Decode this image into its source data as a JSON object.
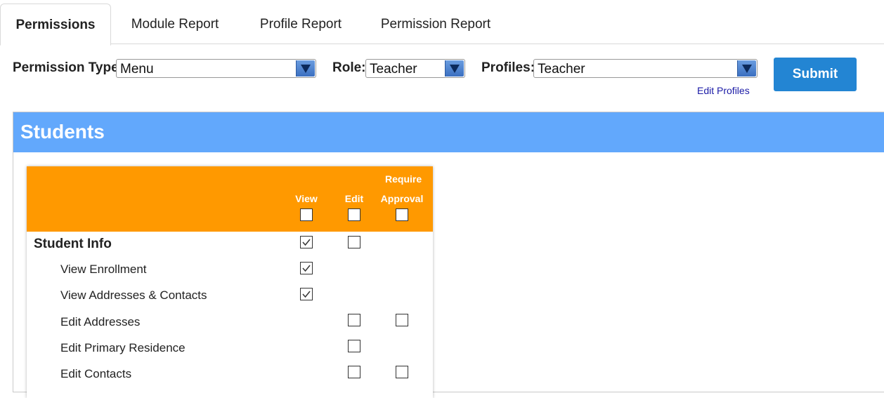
{
  "tabs": [
    {
      "label": "Permissions",
      "active": true
    },
    {
      "label": "Module Report",
      "active": false
    },
    {
      "label": "Profile Report",
      "active": false
    },
    {
      "label": "Permission Report",
      "active": false
    }
  ],
  "filters": {
    "permission_type_label": "Permission Type:",
    "permission_type_value": "Menu",
    "role_label": "Role:",
    "role_value": "Teacher",
    "profiles_label": "Profiles:",
    "profiles_value": "Teacher",
    "edit_profiles_link": "Edit Profiles",
    "submit_label": "Submit"
  },
  "section": {
    "title": "Students",
    "columns": {
      "view": "View",
      "edit": "Edit",
      "require_line1": "Require",
      "require_line2": "Approval"
    },
    "header_checks": {
      "view": false,
      "edit": false,
      "require": false
    },
    "rows": [
      {
        "label": "Student Info",
        "level": 0,
        "view": true,
        "edit": false,
        "require": null
      },
      {
        "label": "View Enrollment",
        "level": 1,
        "view": true,
        "edit": null,
        "require": null
      },
      {
        "label": "View Addresses & Contacts",
        "level": 1,
        "view": true,
        "edit": null,
        "require": null
      },
      {
        "label": "Edit Addresses",
        "level": 1,
        "view": null,
        "edit": false,
        "require": false
      },
      {
        "label": "Edit Primary Residence",
        "level": 1,
        "view": null,
        "edit": false,
        "require": null
      },
      {
        "label": "Edit Contacts",
        "level": 1,
        "view": null,
        "edit": false,
        "require": false
      }
    ]
  },
  "colors": {
    "tab_border": "#d9d9d9",
    "submit_bg": "#2385d3",
    "section_header_bg": "#62a8fc",
    "table_header_bg": "#ff9900",
    "link": "#1a1aa6"
  },
  "icons": {
    "dropdown": "chevron-down-icon",
    "check": "checkmark-icon"
  }
}
